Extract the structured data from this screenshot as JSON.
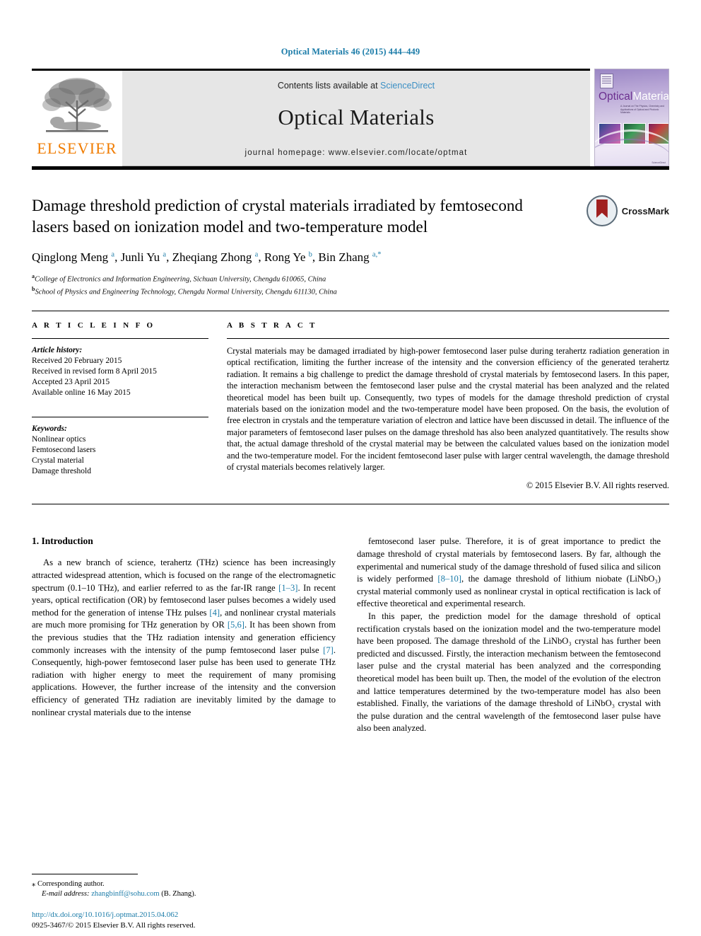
{
  "running_head": "Optical Materials 46 (2015) 444–449",
  "masthead": {
    "publisher_wordmark": "ELSEVIER",
    "contents_prefix": "Contents lists available at ",
    "sciencedirect": "ScienceDirect",
    "journal_name": "Optical Materials",
    "homepage": "journal homepage: www.elsevier.com/locate/optmat",
    "cover": {
      "title_part1": "Optical",
      "title_part2": "Materials",
      "subtitle": "A Journal on The Physics, Chemistry and Applications of Optical and Photonic Materials",
      "footer": "ScienceDirect"
    }
  },
  "article": {
    "title": "Damage threshold prediction of crystal materials irradiated by femtosecond lasers based on ionization model and two-temperature model",
    "crossmark_label": "CrossMark",
    "authors_html": "Qinglong Meng <sup>a</sup>, Junli Yu <sup>a</sup>, Zheqiang Zhong <sup>a</sup>, Rong Ye <sup>b</sup>, Bin Zhang <sup>a,*</sup>",
    "affiliations": [
      {
        "marker": "a",
        "text": "College of Electronics and Information Engineering, Sichuan University, Chengdu 610065, China"
      },
      {
        "marker": "b",
        "text": "School of Physics and Engineering Technology, Chengdu Normal University, Chengdu 611130, China"
      }
    ]
  },
  "article_info": {
    "heading": "A R T I C L E  I N F O",
    "history_label": "Article history:",
    "history": [
      "Received 20 February 2015",
      "Received in revised form 8 April 2015",
      "Accepted 23 April 2015",
      "Available online 16 May 2015"
    ],
    "keywords_label": "Keywords:",
    "keywords": [
      "Nonlinear optics",
      "Femtosecond lasers",
      "Crystal material",
      "Damage threshold"
    ]
  },
  "abstract": {
    "heading": "A B S T R A C T",
    "text": "Crystal materials may be damaged irradiated by high-power femtosecond laser pulse during terahertz radiation generation in optical rectification, limiting the further increase of the intensity and the conversion efficiency of the generated terahertz radiation. It remains a big challenge to predict the damage threshold of crystal materials by femtosecond lasers. In this paper, the interaction mechanism between the femtosecond laser pulse and the crystal material has been analyzed and the related theoretical model has been built up. Consequently, two types of models for the damage threshold prediction of crystal materials based on the ionization model and the two-temperature model have been proposed. On the basis, the evolution of free electron in crystals and the temperature variation of electron and lattice have been discussed in detail. The influence of the major parameters of femtosecond laser pulses on the damage threshold has also been analyzed quantitatively. The results show that, the actual damage threshold of the crystal material may be between the calculated values based on the ionization model and the two-temperature model. For the incident femtosecond laser pulse with larger central wavelength, the damage threshold of crystal materials becomes relatively larger.",
    "copyright": "© 2015 Elsevier B.V. All rights reserved."
  },
  "body": {
    "section_heading": "1. Introduction",
    "left_paragraph_1_a": "As a new branch of science, terahertz (THz) science has been increasingly attracted widespread attention, which is focused on the range of the electromagnetic spectrum (0.1–10 THz), and earlier referred to as the far-IR range ",
    "ref_1_3": "[1–3]",
    "left_paragraph_1_b": ". In recent years, optical rectification (OR) by femtosecond laser pulses becomes a widely used method for the generation of intense THz pulses ",
    "ref_4": "[4]",
    "left_paragraph_1_c": ", and nonlinear crystal materials are much more promising for THz generation by OR ",
    "ref_5_6": "[5,6]",
    "left_paragraph_1_d": ". It has been shown from the previous studies that the THz radiation intensity and generation efficiency commonly increases with the intensity of the pump femtosecond laser pulse ",
    "ref_7": "[7]",
    "left_paragraph_1_e": ". Consequently, high-power femtosecond laser pulse has been used to generate THz radiation with higher energy to meet the requirement of many promising applications. However, the further increase of the intensity and the conversion efficiency of generated THz radiation are inevitably limited by the damage to nonlinear crystal materials due to the intense",
    "right_paragraph_1_a": "femtosecond laser pulse. Therefore, it is of great importance to predict the damage threshold of crystal materials by femtosecond lasers. By far, although the experimental and numerical study of the damage threshold of fused silica and silicon is widely performed ",
    "ref_8_10": "[8–10]",
    "right_paragraph_1_b": ", the damage threshold of lithium niobate (LiNbO₃) crystal material commonly used as nonlinear crystal in optical rectification is lack of effective theoretical and experimental research.",
    "right_paragraph_2": "In this paper, the prediction model for the damage threshold of optical rectification crystals based on the ionization model and the two-temperature model have been proposed. The damage threshold of the LiNbO₃ crystal has further been predicted and discussed. Firstly, the interaction mechanism between the femtosecond laser pulse and the crystal material has been analyzed and the corresponding theoretical model has been built up. Then, the model of the evolution of the electron and lattice temperatures determined by the two-temperature model has also been established. Finally, the variations of the damage threshold of LiNbO₃ crystal with the pulse duration and the central wavelength of the femtosecond laser pulse have also been analyzed."
  },
  "footer": {
    "corresponding_marker": "⁎",
    "corresponding_author": "Corresponding author.",
    "email_label": "E-mail address:",
    "email": "zhangbinff@sohu.com",
    "email_owner": "(B. Zhang).",
    "doi": "http://dx.doi.org/10.1016/j.optmat.2015.04.062",
    "issn_line": "0925-3467/© 2015 Elsevier B.V. All rights reserved."
  }
}
